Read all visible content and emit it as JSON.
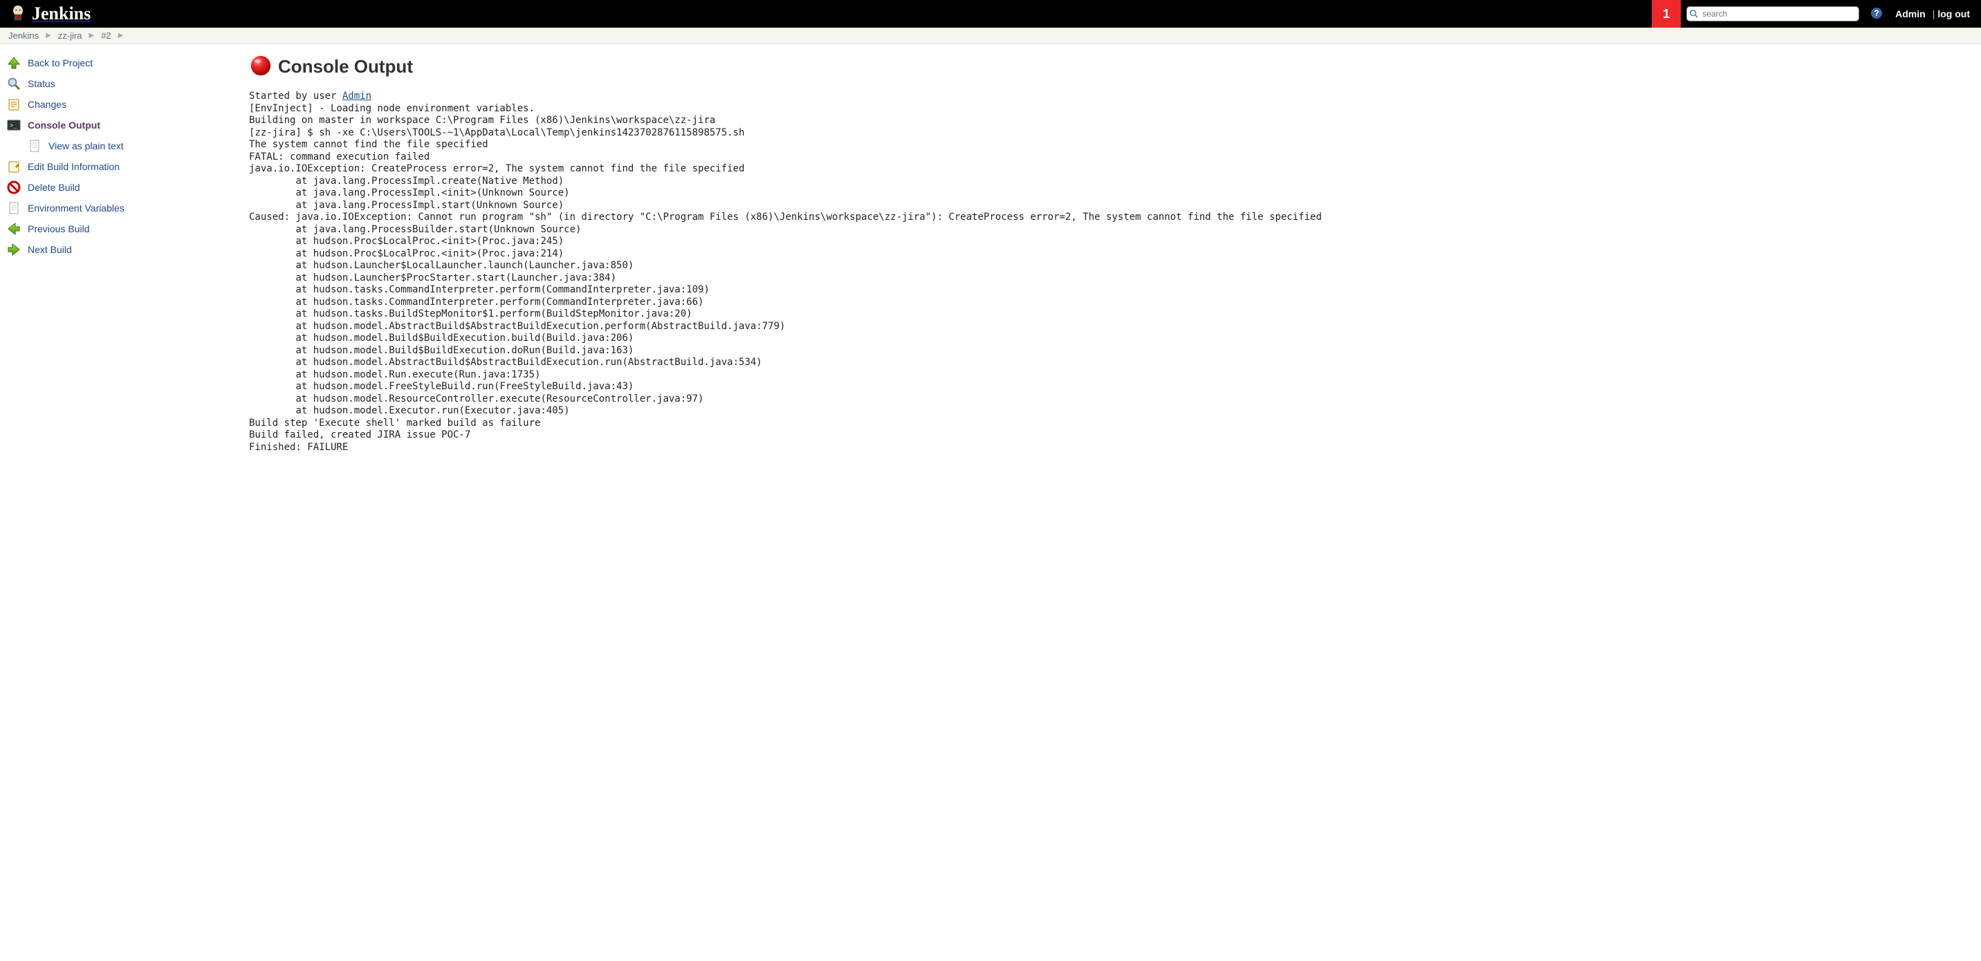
{
  "header": {
    "brand": "Jenkins",
    "notification_count": "1",
    "search_placeholder": "search",
    "admin_label": "Admin",
    "logout_label": "log out"
  },
  "breadcrumbs": [
    {
      "label": "Jenkins"
    },
    {
      "label": "zz-jira"
    },
    {
      "label": "#2"
    }
  ],
  "sidebar": {
    "items": [
      {
        "icon": "arrow-up-green-icon",
        "label": "Back to Project"
      },
      {
        "icon": "magnifier-icon",
        "label": "Status"
      },
      {
        "icon": "notepad-icon",
        "label": "Changes"
      },
      {
        "icon": "terminal-icon",
        "label": "Console Output",
        "active": true
      },
      {
        "icon": "document-icon",
        "label": "View as plain text",
        "sub": true
      },
      {
        "icon": "notepad-edit-icon",
        "label": "Edit Build Information"
      },
      {
        "icon": "no-entry-icon",
        "label": "Delete Build"
      },
      {
        "icon": "document-icon",
        "label": "Environment Variables"
      },
      {
        "icon": "arrow-left-green-icon",
        "label": "Previous Build"
      },
      {
        "icon": "arrow-right-green-icon",
        "label": "Next Build"
      }
    ]
  },
  "main": {
    "title": "Console Output",
    "started_by_prefix": "Started by user ",
    "started_by_user": "Admin",
    "console_rest": "[EnvInject] - Loading node environment variables.\nBuilding on master in workspace C:\\Program Files (x86)\\Jenkins\\workspace\\zz-jira\n[zz-jira] $ sh -xe C:\\Users\\TOOLS-~1\\AppData\\Local\\Temp\\jenkins1423702876115898575.sh\nThe system cannot find the file specified\nFATAL: command execution failed\njava.io.IOException: CreateProcess error=2, The system cannot find the file specified\n        at java.lang.ProcessImpl.create(Native Method)\n        at java.lang.ProcessImpl.<init>(Unknown Source)\n        at java.lang.ProcessImpl.start(Unknown Source)\nCaused: java.io.IOException: Cannot run program \"sh\" (in directory \"C:\\Program Files (x86)\\Jenkins\\workspace\\zz-jira\"): CreateProcess error=2, The system cannot find the file specified\n        at java.lang.ProcessBuilder.start(Unknown Source)\n        at hudson.Proc$LocalProc.<init>(Proc.java:245)\n        at hudson.Proc$LocalProc.<init>(Proc.java:214)\n        at hudson.Launcher$LocalLauncher.launch(Launcher.java:850)\n        at hudson.Launcher$ProcStarter.start(Launcher.java:384)\n        at hudson.tasks.CommandInterpreter.perform(CommandInterpreter.java:109)\n        at hudson.tasks.CommandInterpreter.perform(CommandInterpreter.java:66)\n        at hudson.tasks.BuildStepMonitor$1.perform(BuildStepMonitor.java:20)\n        at hudson.model.AbstractBuild$AbstractBuildExecution.perform(AbstractBuild.java:779)\n        at hudson.model.Build$BuildExecution.build(Build.java:206)\n        at hudson.model.Build$BuildExecution.doRun(Build.java:163)\n        at hudson.model.AbstractBuild$AbstractBuildExecution.run(AbstractBuild.java:534)\n        at hudson.model.Run.execute(Run.java:1735)\n        at hudson.model.FreeStyleBuild.run(FreeStyleBuild.java:43)\n        at hudson.model.ResourceController.execute(ResourceController.java:97)\n        at hudson.model.Executor.run(Executor.java:405)\nBuild step 'Execute shell' marked build as failure\nBuild failed, created JIRA issue POC-7\nFinished: FAILURE"
  }
}
